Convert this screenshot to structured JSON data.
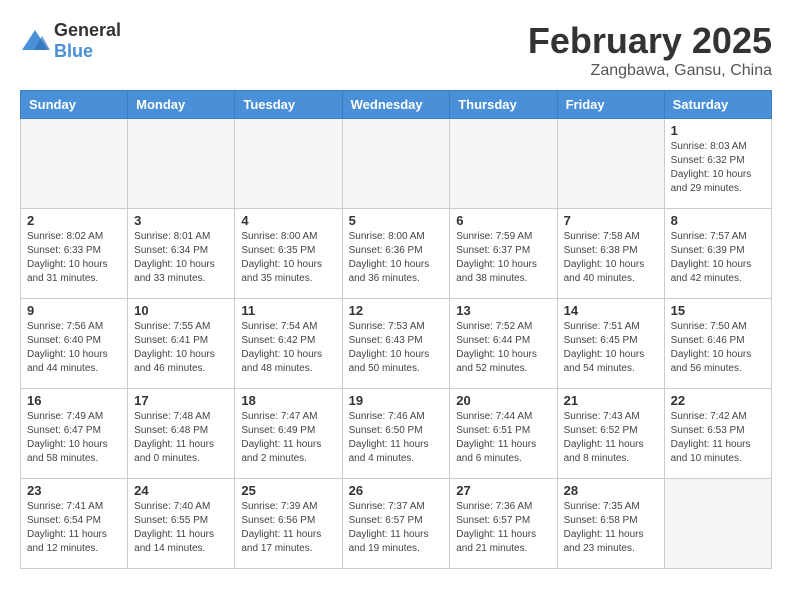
{
  "header": {
    "logo_general": "General",
    "logo_blue": "Blue",
    "month_title": "February 2025",
    "location": "Zangbawa, Gansu, China"
  },
  "weekdays": [
    "Sunday",
    "Monday",
    "Tuesday",
    "Wednesday",
    "Thursday",
    "Friday",
    "Saturday"
  ],
  "weeks": [
    [
      {
        "day": "",
        "info": ""
      },
      {
        "day": "",
        "info": ""
      },
      {
        "day": "",
        "info": ""
      },
      {
        "day": "",
        "info": ""
      },
      {
        "day": "",
        "info": ""
      },
      {
        "day": "",
        "info": ""
      },
      {
        "day": "1",
        "info": "Sunrise: 8:03 AM\nSunset: 6:32 PM\nDaylight: 10 hours and 29 minutes."
      }
    ],
    [
      {
        "day": "2",
        "info": "Sunrise: 8:02 AM\nSunset: 6:33 PM\nDaylight: 10 hours and 31 minutes."
      },
      {
        "day": "3",
        "info": "Sunrise: 8:01 AM\nSunset: 6:34 PM\nDaylight: 10 hours and 33 minutes."
      },
      {
        "day": "4",
        "info": "Sunrise: 8:00 AM\nSunset: 6:35 PM\nDaylight: 10 hours and 35 minutes."
      },
      {
        "day": "5",
        "info": "Sunrise: 8:00 AM\nSunset: 6:36 PM\nDaylight: 10 hours and 36 minutes."
      },
      {
        "day": "6",
        "info": "Sunrise: 7:59 AM\nSunset: 6:37 PM\nDaylight: 10 hours and 38 minutes."
      },
      {
        "day": "7",
        "info": "Sunrise: 7:58 AM\nSunset: 6:38 PM\nDaylight: 10 hours and 40 minutes."
      },
      {
        "day": "8",
        "info": "Sunrise: 7:57 AM\nSunset: 6:39 PM\nDaylight: 10 hours and 42 minutes."
      }
    ],
    [
      {
        "day": "9",
        "info": "Sunrise: 7:56 AM\nSunset: 6:40 PM\nDaylight: 10 hours and 44 minutes."
      },
      {
        "day": "10",
        "info": "Sunrise: 7:55 AM\nSunset: 6:41 PM\nDaylight: 10 hours and 46 minutes."
      },
      {
        "day": "11",
        "info": "Sunrise: 7:54 AM\nSunset: 6:42 PM\nDaylight: 10 hours and 48 minutes."
      },
      {
        "day": "12",
        "info": "Sunrise: 7:53 AM\nSunset: 6:43 PM\nDaylight: 10 hours and 50 minutes."
      },
      {
        "day": "13",
        "info": "Sunrise: 7:52 AM\nSunset: 6:44 PM\nDaylight: 10 hours and 52 minutes."
      },
      {
        "day": "14",
        "info": "Sunrise: 7:51 AM\nSunset: 6:45 PM\nDaylight: 10 hours and 54 minutes."
      },
      {
        "day": "15",
        "info": "Sunrise: 7:50 AM\nSunset: 6:46 PM\nDaylight: 10 hours and 56 minutes."
      }
    ],
    [
      {
        "day": "16",
        "info": "Sunrise: 7:49 AM\nSunset: 6:47 PM\nDaylight: 10 hours and 58 minutes."
      },
      {
        "day": "17",
        "info": "Sunrise: 7:48 AM\nSunset: 6:48 PM\nDaylight: 11 hours and 0 minutes."
      },
      {
        "day": "18",
        "info": "Sunrise: 7:47 AM\nSunset: 6:49 PM\nDaylight: 11 hours and 2 minutes."
      },
      {
        "day": "19",
        "info": "Sunrise: 7:46 AM\nSunset: 6:50 PM\nDaylight: 11 hours and 4 minutes."
      },
      {
        "day": "20",
        "info": "Sunrise: 7:44 AM\nSunset: 6:51 PM\nDaylight: 11 hours and 6 minutes."
      },
      {
        "day": "21",
        "info": "Sunrise: 7:43 AM\nSunset: 6:52 PM\nDaylight: 11 hours and 8 minutes."
      },
      {
        "day": "22",
        "info": "Sunrise: 7:42 AM\nSunset: 6:53 PM\nDaylight: 11 hours and 10 minutes."
      }
    ],
    [
      {
        "day": "23",
        "info": "Sunrise: 7:41 AM\nSunset: 6:54 PM\nDaylight: 11 hours and 12 minutes."
      },
      {
        "day": "24",
        "info": "Sunrise: 7:40 AM\nSunset: 6:55 PM\nDaylight: 11 hours and 14 minutes."
      },
      {
        "day": "25",
        "info": "Sunrise: 7:39 AM\nSunset: 6:56 PM\nDaylight: 11 hours and 17 minutes."
      },
      {
        "day": "26",
        "info": "Sunrise: 7:37 AM\nSunset: 6:57 PM\nDaylight: 11 hours and 19 minutes."
      },
      {
        "day": "27",
        "info": "Sunrise: 7:36 AM\nSunset: 6:57 PM\nDaylight: 11 hours and 21 minutes."
      },
      {
        "day": "28",
        "info": "Sunrise: 7:35 AM\nSunset: 6:58 PM\nDaylight: 11 hours and 23 minutes."
      },
      {
        "day": "",
        "info": ""
      }
    ]
  ]
}
